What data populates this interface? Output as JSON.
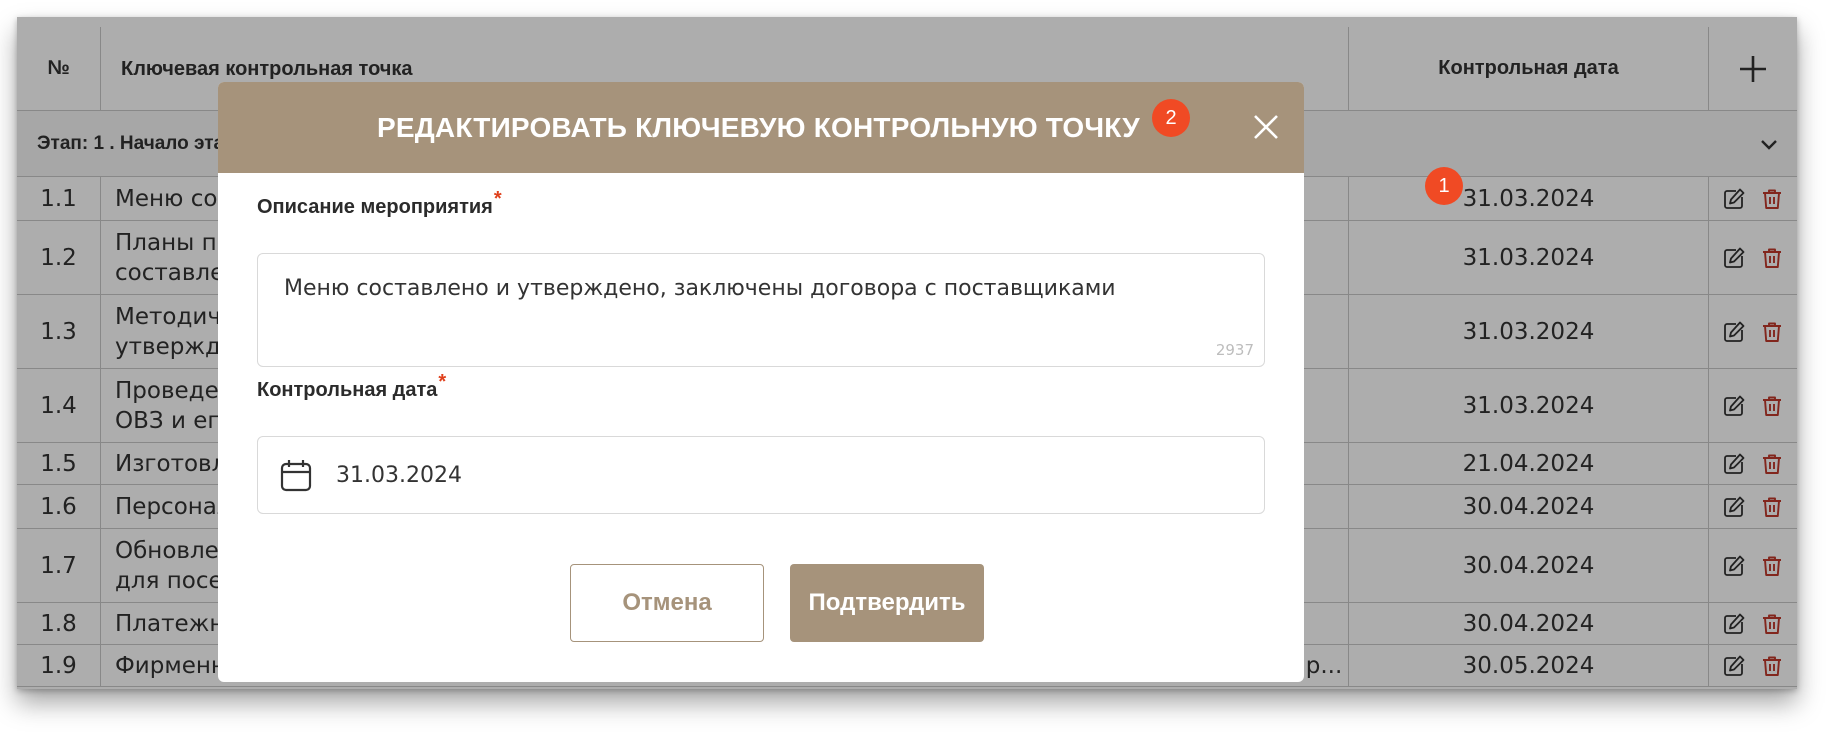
{
  "table": {
    "headers": {
      "num": "№",
      "milestone": "Ключевая контрольная точка",
      "date": "Контрольная дата",
      "add_icon": "plus-icon"
    },
    "stage": {
      "label": "Этап: 1 . Начало этапа",
      "toggle_icon": "chevron-down-icon"
    },
    "rows": [
      {
        "num": "1.1",
        "text": "Меню составлено и утверждено, заключены договора с поставщиками",
        "date": "31.03.2024"
      },
      {
        "num": "1.2",
        "text": "Планы про...\nсоставле...",
        "date": "31.03.2024"
      },
      {
        "num": "1.3",
        "text": "Методиче...\nутвержде...",
        "date": "31.03.2024"
      },
      {
        "num": "1.4",
        "text": "Проведен...\nОВЗ и его...",
        "date": "31.03.2024"
      },
      {
        "num": "1.5",
        "text": "Изготовл...",
        "date": "21.04.2024"
      },
      {
        "num": "1.6",
        "text": "Персонал...",
        "date": "30.04.2024"
      },
      {
        "num": "1.7",
        "text": "Обновлен...\nдля посет...",
        "date": "30.04.2024"
      },
      {
        "num": "1.8",
        "text": "Платежн...",
        "date": "30.04.2024"
      },
      {
        "num": "1.9",
        "text": "Фирменный стиль разработан и внедрен в интерьер и экстерьер кафе, в фирменную одежду и пр...",
        "date": "30.05.2024"
      }
    ],
    "row_actions": {
      "edit_icon": "edit-icon",
      "delete_icon": "trash-icon"
    }
  },
  "badges": {
    "first": "1",
    "second": "2"
  },
  "modal": {
    "title": "РЕДАКТИРОВАТЬ КЛЮЧЕВУЮ КОНТРОЛЬНУЮ ТОЧКУ",
    "close_icon": "close-icon",
    "description_label": "Описание мероприятия",
    "description_value": "Меню составлено и утверждено, заключены договора с поставщиками",
    "description_counter": "2937",
    "date_label": "Контрольная дата",
    "date_value": "31.03.2024",
    "date_icon": "calendar-icon",
    "required_mark": "*",
    "cancel_label": "Отмена",
    "confirm_label": "Подтвердить"
  },
  "colors": {
    "accent": "#a6937b",
    "badge": "#f04a24",
    "delete": "#c0392b"
  }
}
